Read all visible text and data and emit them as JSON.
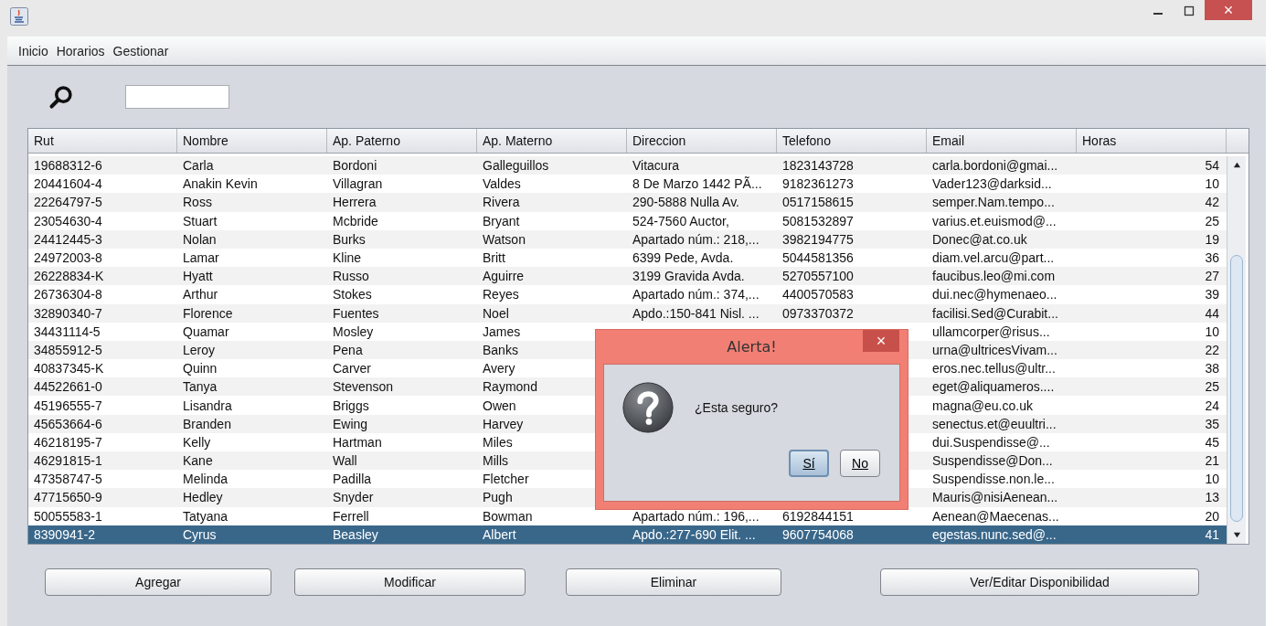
{
  "menu": [
    "Inicio",
    "Horarios",
    "Gestionar"
  ],
  "table": {
    "columns": [
      "Rut",
      "Nombre",
      "Ap. Paterno",
      "Ap. Materno",
      "Direccion",
      "Telefono",
      "Email",
      "Horas"
    ],
    "rows": [
      {
        "cells": [
          "19688312-6",
          "Carla",
          "Bordoni",
          "Galleguillos",
          "Vitacura",
          "1823143728",
          "carla.bordoni@gmai...",
          "54"
        ],
        "selected": false
      },
      {
        "cells": [
          "20441604-4",
          "Anakin Kevin",
          "Villagran",
          "Valdes",
          "8 De Marzo 1442 PÃ...",
          "9182361273",
          "Vader123@darksid...",
          "10"
        ],
        "selected": false
      },
      {
        "cells": [
          "22264797-5",
          "Ross",
          "Herrera",
          "Rivera",
          "290-5888 Nulla Av.",
          "0517158615",
          "semper.Nam.tempo...",
          "42"
        ],
        "selected": false
      },
      {
        "cells": [
          "23054630-4",
          "Stuart",
          "Mcbride",
          "Bryant",
          "524-7560 Auctor,",
          "5081532897",
          "varius.et.euismod@...",
          "25"
        ],
        "selected": false
      },
      {
        "cells": [
          "24412445-3",
          "Nolan",
          "Burks",
          "Watson",
          "Apartado núm.: 218,...",
          "3982194775",
          "Donec@at.co.uk",
          "19"
        ],
        "selected": false
      },
      {
        "cells": [
          "24972003-8",
          "Lamar",
          "Kline",
          "Britt",
          "6399 Pede, Avda.",
          "5044581356",
          "diam.vel.arcu@part...",
          "36"
        ],
        "selected": false
      },
      {
        "cells": [
          "26228834-K",
          "Hyatt",
          "Russo",
          "Aguirre",
          "3199 Gravida Avda.",
          "5270557100",
          "faucibus.leo@mi.com",
          "27"
        ],
        "selected": false
      },
      {
        "cells": [
          "26736304-8",
          "Arthur",
          "Stokes",
          "Reyes",
          "Apartado núm.: 374,...",
          "4400570583",
          "dui.nec@hymenaeo...",
          "39"
        ],
        "selected": false
      },
      {
        "cells": [
          "32890340-7",
          "Florence",
          "Fuentes",
          "Noel",
          "Apdo.:150-841 Nisl. ...",
          "0973370372",
          "facilisi.Sed@Curabit...",
          "44"
        ],
        "selected": false
      },
      {
        "cells": [
          "34431114-5",
          "Quamar",
          "Mosley",
          "James",
          null,
          null,
          "ullamcorper@risus...",
          "10"
        ],
        "selected": false
      },
      {
        "cells": [
          "34855912-5",
          "Leroy",
          "Pena",
          "Banks",
          null,
          null,
          "urna@ultricesVivam...",
          "22"
        ],
        "selected": false
      },
      {
        "cells": [
          "40837345-K",
          "Quinn",
          "Carver",
          "Avery",
          null,
          null,
          "eros.nec.tellus@ultr...",
          "38"
        ],
        "selected": false
      },
      {
        "cells": [
          "44522661-0",
          "Tanya",
          "Stevenson",
          "Raymond",
          null,
          null,
          "eget@aliquameros....",
          "25"
        ],
        "selected": false
      },
      {
        "cells": [
          "45196555-7",
          "Lisandra",
          "Briggs",
          "Owen",
          null,
          null,
          "magna@eu.co.uk",
          "24"
        ],
        "selected": false
      },
      {
        "cells": [
          "45653664-6",
          "Branden",
          "Ewing",
          "Harvey",
          null,
          null,
          "senectus.et@euultri...",
          "35"
        ],
        "selected": false
      },
      {
        "cells": [
          "46218195-7",
          "Kelly",
          "Hartman",
          "Miles",
          null,
          null,
          "dui.Suspendisse@...",
          "45"
        ],
        "selected": false
      },
      {
        "cells": [
          "46291815-1",
          "Kane",
          "Wall",
          "Mills",
          null,
          null,
          "Suspendisse@Don...",
          "21"
        ],
        "selected": false
      },
      {
        "cells": [
          "47358747-5",
          "Melinda",
          "Padilla",
          "Fletcher",
          null,
          null,
          "Suspendisse.non.le...",
          "10"
        ],
        "selected": false
      },
      {
        "cells": [
          "47715650-9",
          "Hedley",
          "Snyder",
          "Pugh",
          null,
          null,
          "Mauris@nisiAenean...",
          "13"
        ],
        "selected": false
      },
      {
        "cells": [
          "50055583-1",
          "Tatyana",
          "Ferrell",
          "Bowman",
          "Apartado núm.: 196,...",
          "6192844151",
          "Aenean@Maecenas...",
          "20"
        ],
        "selected": false
      },
      {
        "cells": [
          "8390941-2",
          "Cyrus",
          "Beasley",
          "Albert",
          "Apdo.:277-690 Elit. ...",
          "9607754068",
          "egestas.nunc.sed@...",
          "41"
        ],
        "selected": true
      }
    ]
  },
  "buttons": [
    "Agregar",
    "Modificar",
    "Eliminar",
    "Ver/Editar Disponibilidad"
  ],
  "dialog": {
    "title": "Alerta!",
    "close": "×",
    "message": "¿Esta seguro?",
    "buttons": [
      {
        "label": "Sí",
        "selected": true
      },
      {
        "label": "No",
        "selected": false
      }
    ]
  },
  "window_controls": {
    "close": "×"
  }
}
